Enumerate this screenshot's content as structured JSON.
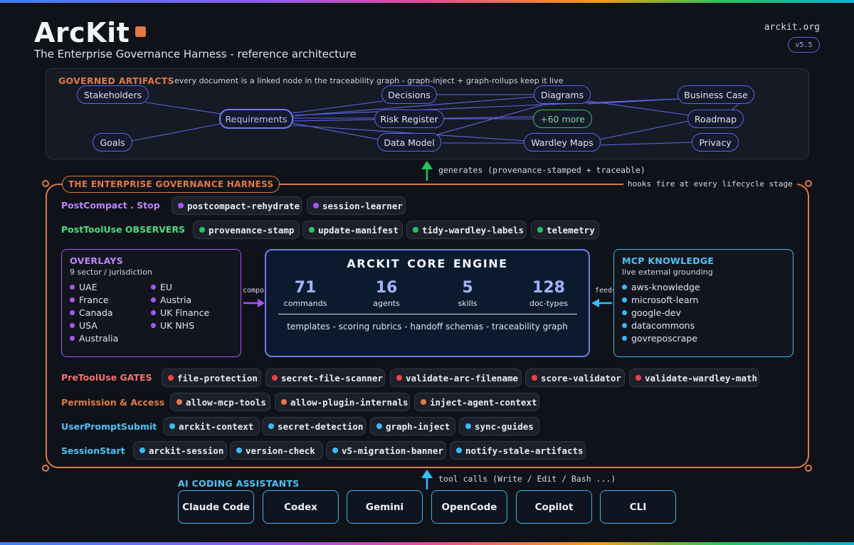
{
  "header": {
    "title": "ArcKit",
    "subtitle": "The Enterprise Governance Harness  -  reference architecture",
    "site": "arckit.org",
    "version": "v5.5"
  },
  "governed": {
    "title": "GOVERNED ARTIFACTS",
    "description": "every document is a linked node in the traceability graph  -  graph-inject + graph-rollups keep it live",
    "nodes": {
      "stakeholders": "Stakeholders",
      "goals": "Goals",
      "requirements": "Requirements",
      "decisions": "Decisions",
      "risk": "Risk Register",
      "datamodel": "Data Model",
      "diagrams": "Diagrams",
      "more": "+60 more",
      "wardley": "Wardley Maps",
      "business": "Business Case",
      "roadmap": "Roadmap",
      "privacy": "Privacy"
    }
  },
  "generates_text": "generates  (provenance-stamped + traceable)",
  "harness": {
    "label": "THE ENTERPRISE GOVERNANCE HARNESS",
    "hooks_note": "hooks fire at every lifecycle stage",
    "rows": {
      "postcompact": {
        "label": "PostCompact . Stop",
        "chips": [
          "postcompact-rehydrate",
          "session-learner"
        ]
      },
      "posttool": {
        "label": "PostToolUse  OBSERVERS",
        "chips": [
          "provenance-stamp",
          "update-manifest",
          "tidy-wardley-labels",
          "telemetry"
        ]
      },
      "pretool": {
        "label": "PreToolUse  GATES",
        "chips": [
          "file-protection",
          "secret-file-scanner",
          "validate-arc-filename",
          "score-validator",
          "validate-wardley-math"
        ]
      },
      "permission": {
        "label": "Permission & Access",
        "chips": [
          "allow-mcp-tools",
          "allow-plugin-internals",
          "inject-agent-context"
        ]
      },
      "userprompt": {
        "label": "UserPromptSubmit",
        "chips": [
          "arckit-context",
          "secret-detection",
          "graph-inject",
          "sync-guides"
        ]
      },
      "session": {
        "label": "SessionStart",
        "chips": [
          "arckit-session",
          "version-check",
          "v5-migration-banner",
          "notify-stale-artifacts"
        ]
      }
    },
    "overlays": {
      "title": "OVERLAYS",
      "subtitle": "9 sector / jurisdiction",
      "col1": [
        "UAE",
        "France",
        "Canada",
        "USA",
        "Australia"
      ],
      "col2": [
        "EU",
        "Austria",
        "UK Finance",
        "UK NHS"
      ]
    },
    "compose": "compose",
    "core": {
      "title": "ARCKIT  CORE  ENGINE",
      "stats": [
        {
          "num": "71",
          "label": "commands"
        },
        {
          "num": "16",
          "label": "agents"
        },
        {
          "num": "5",
          "label": "skills"
        },
        {
          "num": "128",
          "label": "doc-types"
        }
      ],
      "footer": "templates  -  scoring rubrics  -  handoff schemas  -  traceability graph"
    },
    "feeds": "feeds",
    "mcp": {
      "title": "MCP  KNOWLEDGE",
      "subtitle": "live external grounding",
      "items": [
        "aws-knowledge",
        "microsoft-learn",
        "google-dev",
        "datacommons",
        "govreposcrape"
      ]
    }
  },
  "tool_calls_text": "tool calls  (Write / Edit / Bash ...)",
  "assistants": {
    "title": "AI CODING ASSISTANTS",
    "items": [
      "Claude Code",
      "Codex",
      "Gemini",
      "OpenCode",
      "Copilot",
      "CLI"
    ]
  },
  "colors": {
    "orange": "#e07a45",
    "purple": "#a855f7",
    "green": "#22c55e",
    "red": "#ef4444",
    "cyan": "#38bdf8",
    "indigo": "#6b7cf0"
  }
}
